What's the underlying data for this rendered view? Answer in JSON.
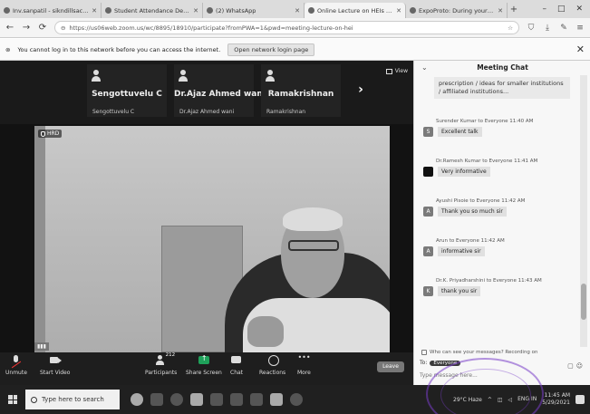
{
  "browser": {
    "tabs": [
      {
        "title": "Inv.sanpatil - sikndillsachedu",
        "active": false
      },
      {
        "title": "Student Attendance Details",
        "active": false
      },
      {
        "title": "(2) WhatsApp",
        "active": false
      },
      {
        "title": "Online Lecture on HEIs Rating",
        "active": true
      },
      {
        "title": "ExpoProto: During your pilot",
        "active": false
      }
    ],
    "new_tab": "+",
    "url": "https://us06web.zoom.us/wc/8895/18910/participate?fromPWA=1&pwd=meeting-lecture-on-hei",
    "info_text": "You cannot log in to this network before you can access the internet.",
    "info_button": "Open network login page"
  },
  "meeting": {
    "gallery": [
      {
        "name": "Sengottuvelu C",
        "sub": "Sengottuvelu C"
      },
      {
        "name": "Dr.Ajaz Ahmed wani",
        "sub": "Dr.Ajaz Ahmed wani"
      },
      {
        "name": "Ramakrishnan",
        "sub": "Ramakrishnan"
      }
    ],
    "view_label": "View",
    "video_badge": "HRD",
    "toolbar": {
      "unmute": "Unmute",
      "start_video": "Start Video",
      "participants": "Participants",
      "participants_count": "212",
      "share": "Share Screen",
      "chat": "Chat",
      "reactions": "Reactions",
      "more": "More",
      "leave": "Leave"
    }
  },
  "chat": {
    "title": "Meeting Chat",
    "top_message": "prescription / ideas for smaller institutions / affiliated institutions...",
    "messages": [
      {
        "sender": "Surender Kumar to Everyone 11:40 AM",
        "text": "Excellent talk",
        "avatar": "S",
        "dark": false
      },
      {
        "sender": "Dr.Ramesh Kumar to Everyone 11:41 AM",
        "text": "Very informative",
        "avatar": "",
        "dark": true
      },
      {
        "sender": "Ayushi Pisoie to Everyone 11:42 AM",
        "text": "Thank you so much sir",
        "avatar": "A",
        "dark": false
      },
      {
        "sender": "Arun to Everyone 11:42 AM",
        "text": "informative sir",
        "avatar": "A",
        "dark": false
      },
      {
        "sender": "Dr.K. Priyadharshini to Everyone 11:43 AM",
        "text": "thank you sir",
        "avatar": "K",
        "dark": false
      }
    ],
    "notice": "Who can see your messages? Recording on",
    "to_label": "To:",
    "to_target": "Everyone",
    "input_placeholder": "Type message here..."
  },
  "taskbar": {
    "search_placeholder": "Type here to search",
    "weather": "29°C Haze",
    "lang": "ENG IN",
    "time": "11:45 AM",
    "date": "5/29/2021"
  }
}
